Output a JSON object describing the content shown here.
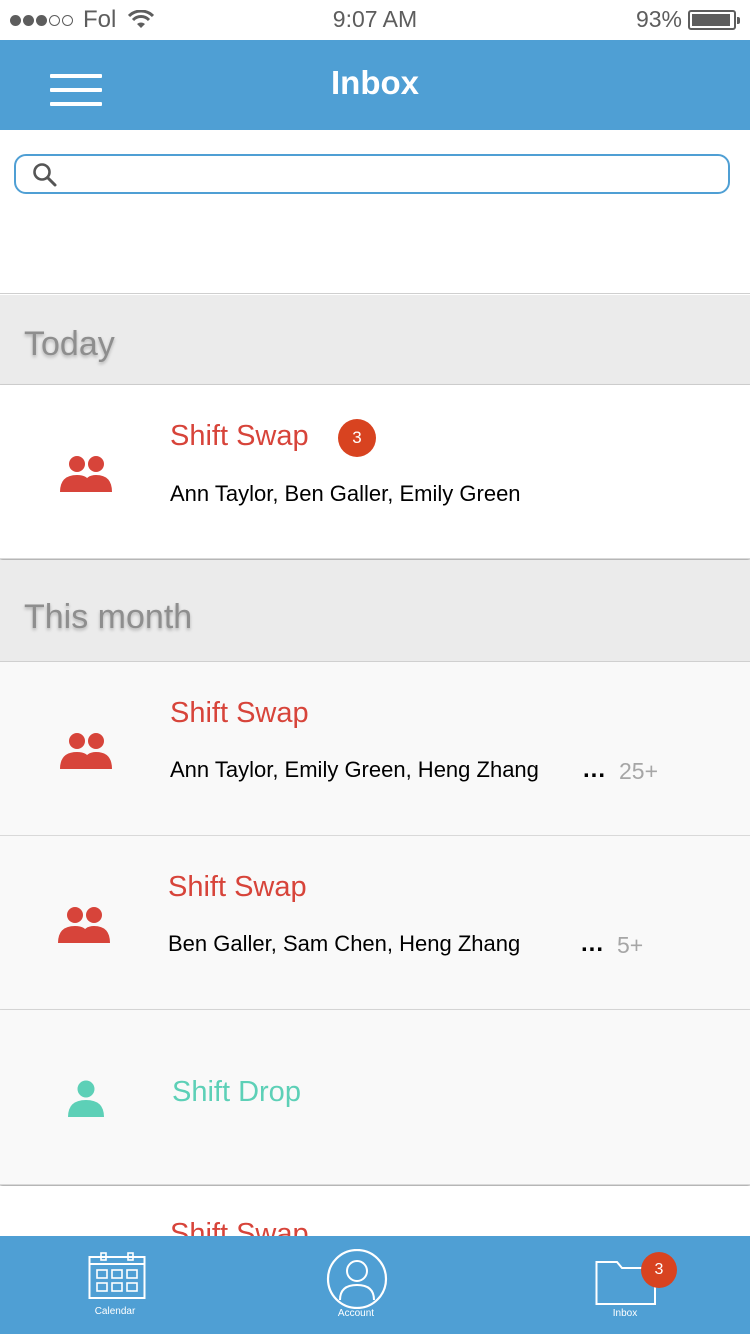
{
  "status_bar": {
    "carrier": "Fol",
    "time": "9:07 AM",
    "battery": "93%"
  },
  "header": {
    "title": "Inbox",
    "menu_icon": "hamburger-menu-icon"
  },
  "search": {
    "placeholder": "",
    "icon": "search-icon"
  },
  "sections": [
    {
      "label": "Today",
      "items": [
        {
          "title": "Shift Swap",
          "participants": "Ann Taylor, Ben Galler, Emily Green",
          "badge": "3",
          "icon": "group-icon",
          "color": "#d7443a"
        }
      ]
    },
    {
      "label": "This month",
      "items": [
        {
          "title": "Shift Swap",
          "participants": "Ann Taylor, Emily Green, Heng Zhang",
          "more": "...",
          "count": "25+",
          "icon": "group-icon",
          "color": "#d7443a"
        },
        {
          "title": "Shift Swap",
          "participants": "Ben Galler, Sam Chen, Heng Zhang",
          "more": "...",
          "count": "5+",
          "icon": "group-icon",
          "color": "#d7443a"
        },
        {
          "title": "Shift Drop",
          "icon": "person-icon",
          "color": "#5dd0b7"
        },
        {
          "title": "Shift Swap",
          "icon": "group-icon",
          "color": "#d7443a"
        }
      ]
    }
  ],
  "tab_bar": {
    "tabs": [
      {
        "label": "Calendar",
        "icon": "calendar-icon"
      },
      {
        "label": "Account",
        "icon": "account-icon"
      },
      {
        "label": "Inbox",
        "icon": "folder-icon",
        "badge": "3"
      }
    ]
  },
  "colors": {
    "primary": "#4f9fd4",
    "swap_red": "#d7443a",
    "drop_teal": "#5dd0b7",
    "badge": "#d84320"
  }
}
